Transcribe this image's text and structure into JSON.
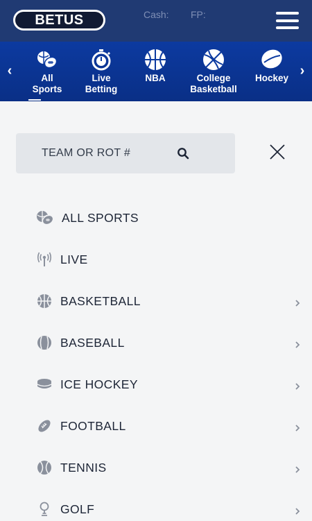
{
  "header": {
    "logo_text_bet": "BET",
    "logo_text_us": "US",
    "cash_label": "Cash:",
    "fp_label": "FP:"
  },
  "sport_nav": {
    "prev_arrow": "‹",
    "next_arrow": "›",
    "tabs": [
      {
        "label": "All\nSports",
        "icon": "all-sports-icon",
        "active": true
      },
      {
        "label": "Live\nBetting",
        "icon": "stopwatch-icon",
        "active": false
      },
      {
        "label": "NBA",
        "icon": "basketball-icon",
        "active": false
      },
      {
        "label": "College\nBasketball",
        "icon": "basketball-icon",
        "active": false
      },
      {
        "label": "Hockey",
        "icon": "hockey-puck-icon",
        "active": false
      }
    ]
  },
  "menu": {
    "search_placeholder": "TEAM OR ROT #",
    "items": [
      {
        "label": "ALL SPORTS",
        "icon": "all-sports-icon",
        "has_chevron": false
      },
      {
        "label": "LIVE",
        "icon": "live-broadcast-icon",
        "has_chevron": false
      },
      {
        "label": "BASKETBALL",
        "icon": "basketball-icon",
        "has_chevron": true
      },
      {
        "label": "BASEBALL",
        "icon": "baseball-icon",
        "has_chevron": true
      },
      {
        "label": "ICE HOCKEY",
        "icon": "hockey-puck-icon",
        "has_chevron": true
      },
      {
        "label": "FOOTBALL",
        "icon": "football-icon",
        "has_chevron": true
      },
      {
        "label": "TENNIS",
        "icon": "tennis-ball-icon",
        "has_chevron": true
      },
      {
        "label": "GOLF",
        "icon": "golf-icon",
        "has_chevron": true
      }
    ]
  },
  "colors": {
    "header_bg": "#203a73",
    "nav_bg": "#0c3aa0",
    "panel_bg": "#f4f5f6",
    "search_bg": "#e3e6ea",
    "text": "#1d2536",
    "icon_gray": "#8a909c"
  }
}
